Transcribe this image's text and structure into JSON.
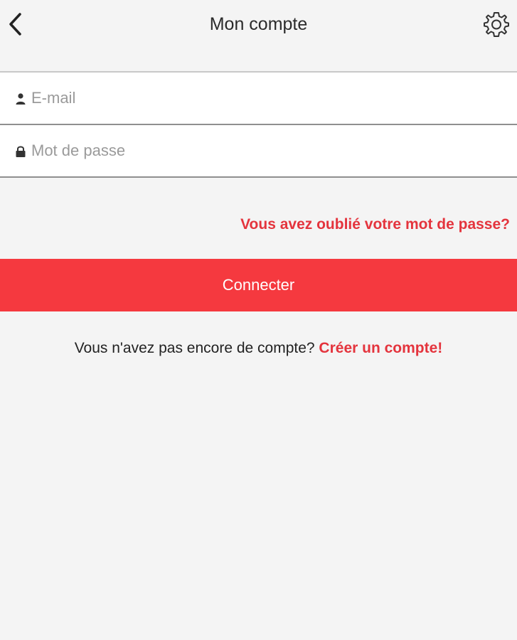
{
  "header": {
    "title": "Mon compte",
    "back_icon": "chevron-left-icon",
    "settings_icon": "gear-icon"
  },
  "form": {
    "email_placeholder": "E-mail",
    "email_icon": "user-icon",
    "email_value": "",
    "password_placeholder": "Mot de passe",
    "password_icon": "lock-icon",
    "password_value": ""
  },
  "links": {
    "forgot_password": "Vous avez oublié votre mot de passe?"
  },
  "actions": {
    "connect_label": "Connecter"
  },
  "signup": {
    "prompt": "Vous n'avez pas encore de compte?",
    "link": "Créer un compte!"
  },
  "colors": {
    "accent": "#f5393f",
    "link": "#e4343d",
    "background": "#f4f4f4"
  }
}
